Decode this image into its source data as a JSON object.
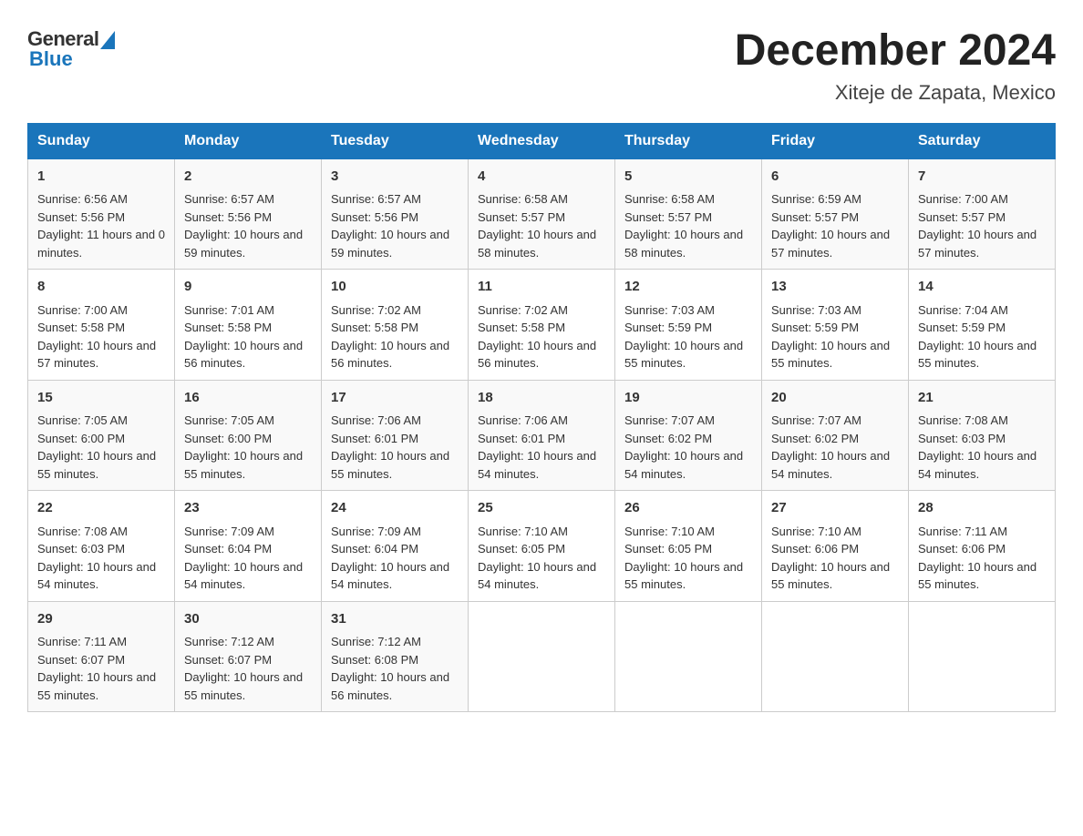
{
  "header": {
    "logo_general": "General",
    "logo_blue": "Blue",
    "main_title": "December 2024",
    "subtitle": "Xiteje de Zapata, Mexico"
  },
  "days_of_week": [
    "Sunday",
    "Monday",
    "Tuesday",
    "Wednesday",
    "Thursday",
    "Friday",
    "Saturday"
  ],
  "weeks": [
    [
      {
        "day": "1",
        "sunrise": "6:56 AM",
        "sunset": "5:56 PM",
        "daylight": "11 hours and 0 minutes."
      },
      {
        "day": "2",
        "sunrise": "6:57 AM",
        "sunset": "5:56 PM",
        "daylight": "10 hours and 59 minutes."
      },
      {
        "day": "3",
        "sunrise": "6:57 AM",
        "sunset": "5:56 PM",
        "daylight": "10 hours and 59 minutes."
      },
      {
        "day": "4",
        "sunrise": "6:58 AM",
        "sunset": "5:57 PM",
        "daylight": "10 hours and 58 minutes."
      },
      {
        "day": "5",
        "sunrise": "6:58 AM",
        "sunset": "5:57 PM",
        "daylight": "10 hours and 58 minutes."
      },
      {
        "day": "6",
        "sunrise": "6:59 AM",
        "sunset": "5:57 PM",
        "daylight": "10 hours and 57 minutes."
      },
      {
        "day": "7",
        "sunrise": "7:00 AM",
        "sunset": "5:57 PM",
        "daylight": "10 hours and 57 minutes."
      }
    ],
    [
      {
        "day": "8",
        "sunrise": "7:00 AM",
        "sunset": "5:58 PM",
        "daylight": "10 hours and 57 minutes."
      },
      {
        "day": "9",
        "sunrise": "7:01 AM",
        "sunset": "5:58 PM",
        "daylight": "10 hours and 56 minutes."
      },
      {
        "day": "10",
        "sunrise": "7:02 AM",
        "sunset": "5:58 PM",
        "daylight": "10 hours and 56 minutes."
      },
      {
        "day": "11",
        "sunrise": "7:02 AM",
        "sunset": "5:58 PM",
        "daylight": "10 hours and 56 minutes."
      },
      {
        "day": "12",
        "sunrise": "7:03 AM",
        "sunset": "5:59 PM",
        "daylight": "10 hours and 55 minutes."
      },
      {
        "day": "13",
        "sunrise": "7:03 AM",
        "sunset": "5:59 PM",
        "daylight": "10 hours and 55 minutes."
      },
      {
        "day": "14",
        "sunrise": "7:04 AM",
        "sunset": "5:59 PM",
        "daylight": "10 hours and 55 minutes."
      }
    ],
    [
      {
        "day": "15",
        "sunrise": "7:05 AM",
        "sunset": "6:00 PM",
        "daylight": "10 hours and 55 minutes."
      },
      {
        "day": "16",
        "sunrise": "7:05 AM",
        "sunset": "6:00 PM",
        "daylight": "10 hours and 55 minutes."
      },
      {
        "day": "17",
        "sunrise": "7:06 AM",
        "sunset": "6:01 PM",
        "daylight": "10 hours and 55 minutes."
      },
      {
        "day": "18",
        "sunrise": "7:06 AM",
        "sunset": "6:01 PM",
        "daylight": "10 hours and 54 minutes."
      },
      {
        "day": "19",
        "sunrise": "7:07 AM",
        "sunset": "6:02 PM",
        "daylight": "10 hours and 54 minutes."
      },
      {
        "day": "20",
        "sunrise": "7:07 AM",
        "sunset": "6:02 PM",
        "daylight": "10 hours and 54 minutes."
      },
      {
        "day": "21",
        "sunrise": "7:08 AM",
        "sunset": "6:03 PM",
        "daylight": "10 hours and 54 minutes."
      }
    ],
    [
      {
        "day": "22",
        "sunrise": "7:08 AM",
        "sunset": "6:03 PM",
        "daylight": "10 hours and 54 minutes."
      },
      {
        "day": "23",
        "sunrise": "7:09 AM",
        "sunset": "6:04 PM",
        "daylight": "10 hours and 54 minutes."
      },
      {
        "day": "24",
        "sunrise": "7:09 AM",
        "sunset": "6:04 PM",
        "daylight": "10 hours and 54 minutes."
      },
      {
        "day": "25",
        "sunrise": "7:10 AM",
        "sunset": "6:05 PM",
        "daylight": "10 hours and 54 minutes."
      },
      {
        "day": "26",
        "sunrise": "7:10 AM",
        "sunset": "6:05 PM",
        "daylight": "10 hours and 55 minutes."
      },
      {
        "day": "27",
        "sunrise": "7:10 AM",
        "sunset": "6:06 PM",
        "daylight": "10 hours and 55 minutes."
      },
      {
        "day": "28",
        "sunrise": "7:11 AM",
        "sunset": "6:06 PM",
        "daylight": "10 hours and 55 minutes."
      }
    ],
    [
      {
        "day": "29",
        "sunrise": "7:11 AM",
        "sunset": "6:07 PM",
        "daylight": "10 hours and 55 minutes."
      },
      {
        "day": "30",
        "sunrise": "7:12 AM",
        "sunset": "6:07 PM",
        "daylight": "10 hours and 55 minutes."
      },
      {
        "day": "31",
        "sunrise": "7:12 AM",
        "sunset": "6:08 PM",
        "daylight": "10 hours and 56 minutes."
      },
      null,
      null,
      null,
      null
    ]
  ]
}
